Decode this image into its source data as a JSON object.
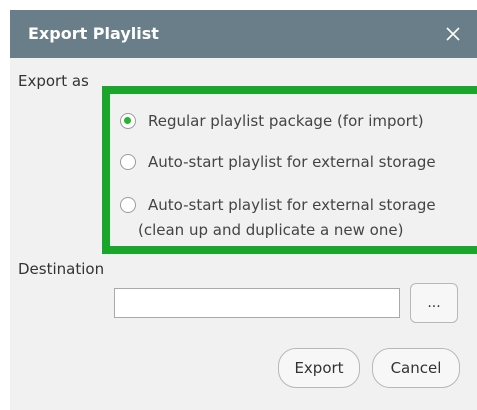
{
  "dialog": {
    "title": "Export Playlist",
    "close_icon": "close-icon"
  },
  "export_as": {
    "label": "Export as",
    "options": [
      {
        "label": "Regular playlist package (for import)",
        "selected": true
      },
      {
        "label": "Auto-start playlist for external storage",
        "selected": false
      },
      {
        "label": "Auto-start playlist for external storage",
        "label_line2": "(clean up and duplicate a new one)",
        "selected": false
      }
    ]
  },
  "destination": {
    "label": "Destination",
    "value": "",
    "browse_label": "..."
  },
  "buttons": {
    "export": "Export",
    "cancel": "Cancel"
  },
  "colors": {
    "titlebar": "#697e89",
    "highlight": "#1aa62a",
    "radio_selected": "#23b52d"
  }
}
